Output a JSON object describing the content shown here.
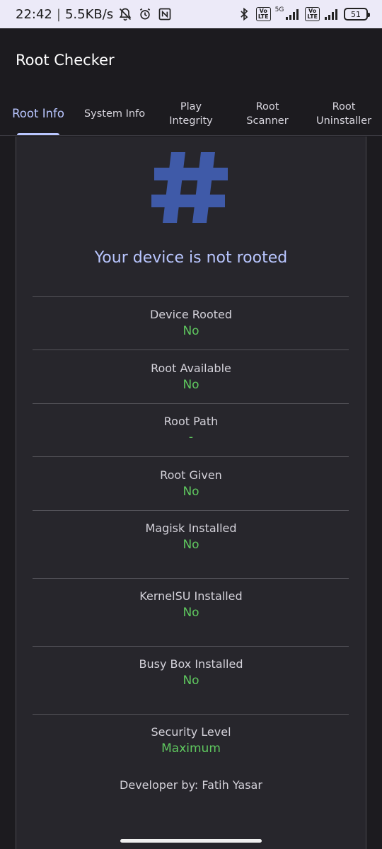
{
  "status_bar": {
    "time": "22:42",
    "separator": "|",
    "net_speed": "5.5KB/s",
    "network_label": "5G",
    "volte_label": "Vo\nLTE",
    "battery": "51",
    "icons": [
      "bell-off-icon",
      "alarm-icon",
      "nfc-icon",
      "bluetooth-icon",
      "signal-icon",
      "signal-icon",
      "battery-icon"
    ]
  },
  "app": {
    "title": "Root Checker"
  },
  "tabs": [
    {
      "label": "Root Info",
      "active": true
    },
    {
      "label": "System Info",
      "active": false
    },
    {
      "label": "Play\nIntegrity",
      "active": false
    },
    {
      "label": "Root\nScanner",
      "active": false
    },
    {
      "label": "Root\nUninstaller",
      "active": false
    }
  ],
  "main": {
    "icon": "hash-icon",
    "headline": "Your device is not rooted",
    "rows": [
      {
        "label": "Device Rooted",
        "value": "No"
      },
      {
        "label": "Root Available",
        "value": "No"
      },
      {
        "label": "Root Path",
        "value": "-"
      },
      {
        "label": "Root Given",
        "value": "No"
      },
      {
        "label": "Magisk Installed",
        "value": "No"
      },
      {
        "label": "KernelSU Installed",
        "value": "No"
      },
      {
        "label": "Busy Box Installed",
        "value": "No"
      },
      {
        "label": "Security Level",
        "value": "Maximum"
      }
    ],
    "developer": "Developer by: Fatih Yasar"
  },
  "colors": {
    "accent": "#b9c6ff",
    "hash": "#3f5aa8",
    "positive": "#5fc85f",
    "background": "#1c1b1f",
    "card": "#27262c"
  }
}
